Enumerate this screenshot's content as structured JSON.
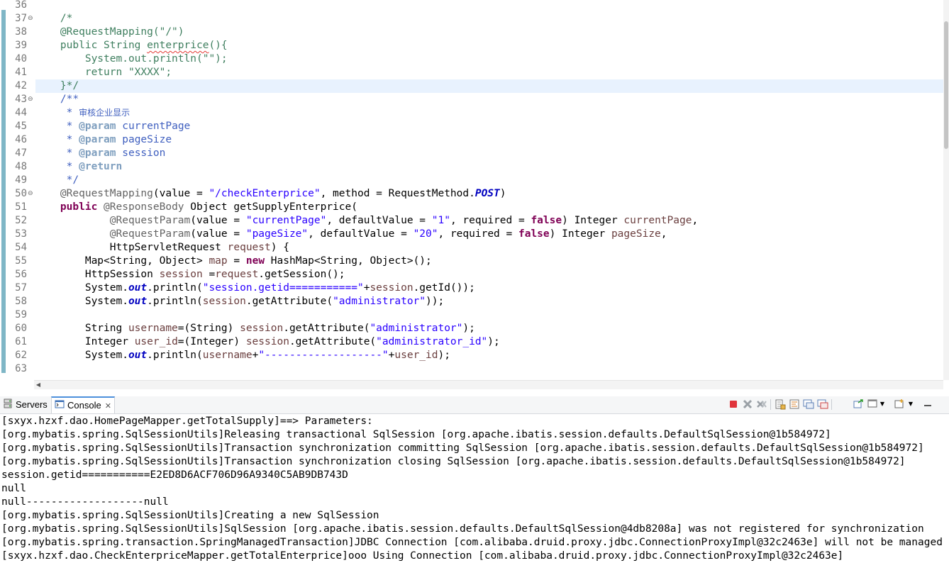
{
  "editor": {
    "line_numbers": [
      "36",
      "37",
      "38",
      "39",
      "40",
      "41",
      "42",
      "43",
      "44",
      "45",
      "46",
      "47",
      "48",
      "49",
      "50",
      "51",
      "52",
      "53",
      "54",
      "55",
      "56",
      "57",
      "58",
      "59",
      "60",
      "61",
      "62",
      "63"
    ],
    "fold_markers": [
      "37",
      "43",
      "50"
    ],
    "current_line": "42",
    "code": {
      "l37": {
        "open": "/*"
      },
      "l38": {
        "text": "@RequestMapping(\"/\")"
      },
      "l39": {
        "a": "public String ",
        "b": "enterprice",
        "c": "(){"
      },
      "l40": {
        "text": "System.out.println(\"\");"
      },
      "l41": {
        "text": "return \"XXXX\";"
      },
      "l42": {
        "text": "}*/"
      },
      "l43": {
        "text": "/**"
      },
      "l44": {
        "star": "* ",
        "text": "审核企业显示"
      },
      "l45": {
        "star": "* ",
        "tag": "@param",
        "name": " currentPage"
      },
      "l46": {
        "star": "* ",
        "tag": "@param",
        "name": " pageSize"
      },
      "l47": {
        "star": "* ",
        "tag": "@param",
        "name": " session"
      },
      "l48": {
        "star": "* ",
        "tag": "@return"
      },
      "l49": {
        "text": "*/"
      },
      "l50": {
        "ann": "@RequestMapping",
        "a": "(value = ",
        "s1": "\"/checkEnterprice\"",
        "b": ", method = RequestMethod.",
        "c": "POST",
        "d": ")"
      },
      "l51": {
        "kw": "public",
        "ann": " @ResponseBody",
        "rest": " Object getSupplyEnterprice("
      },
      "l52": {
        "ann": "@RequestParam",
        "a": "(value = ",
        "s1": "\"currentPage\"",
        "b": ", defaultValue = ",
        "s2": "\"1\"",
        "c": ", required = ",
        "kw": "false",
        "d": ") Integer ",
        "v": "currentPage",
        "e": ","
      },
      "l53": {
        "ann": "@RequestParam",
        "a": "(value = ",
        "s1": "\"pageSize\"",
        "b": ", defaultValue = ",
        "s2": "\"20\"",
        "c": ", required = ",
        "kw": "false",
        "d": ") Integer ",
        "v": "pageSize",
        "e": ","
      },
      "l54": {
        "a": "HttpServletRequest ",
        "v": "request",
        "b": ") {"
      },
      "l55": {
        "a": "Map<String, Object> ",
        "v": "map",
        "b": " = ",
        "kw": "new",
        "c": " HashMap<String, Object>();"
      },
      "l56": {
        "a": "HttpSession ",
        "v": "session",
        "b": " =",
        "v2": "request",
        "c": ".getSession();"
      },
      "l57": {
        "a": "System.",
        "f": "out",
        "b": ".println(",
        "s": "\"session.getid===========\"",
        "c": "+",
        "v": "session",
        "d": ".getId());"
      },
      "l58": {
        "a": "System.",
        "f": "out",
        "b": ".println(",
        "v": "session",
        "c": ".getAttribute(",
        "s": "\"administrator\"",
        "d": "));"
      },
      "l60": {
        "a": "String ",
        "v": "username",
        "b": "=(String) ",
        "v2": "session",
        "c": ".getAttribute(",
        "s": "\"administrator\"",
        "d": ");"
      },
      "l61": {
        "a": "Integer ",
        "v": "user_id",
        "b": "=(Integer) ",
        "v2": "session",
        "c": ".getAttribute(",
        "s": "\"administrator_id\"",
        "d": ");"
      },
      "l62": {
        "a": "System.",
        "f": "out",
        "b": ".println(",
        "v": "username",
        "c": "+",
        "s": "\"-------------------\"",
        "d": "+",
        "v2": "user_id",
        "e": ");"
      }
    }
  },
  "console_view": {
    "tabs": [
      {
        "label": "Servers",
        "icon": "servers-icon"
      },
      {
        "label": "Console",
        "icon": "console-icon",
        "active": true
      }
    ],
    "toolbar_icons": [
      "terminate-icon",
      "remove-launch-icon",
      "remove-all-terminated-icon",
      "scroll-lock-icon",
      "word-wrap-icon",
      "show-on-stdout-icon",
      "show-on-stderr-icon",
      "pin-console-icon",
      "display-console-icon",
      "open-console-icon",
      "minimize-icon"
    ],
    "output": [
      "[sxyx.hzxf.dao.HomePageMapper.getTotalSupply]==> Parameters: ",
      "[org.mybatis.spring.SqlSessionUtils]Releasing transactional SqlSession [org.apache.ibatis.session.defaults.DefaultSqlSession@1b584972]",
      "[org.mybatis.spring.SqlSessionUtils]Transaction synchronization committing SqlSession [org.apache.ibatis.session.defaults.DefaultSqlSession@1b584972]",
      "[org.mybatis.spring.SqlSessionUtils]Transaction synchronization closing SqlSession [org.apache.ibatis.session.defaults.DefaultSqlSession@1b584972]",
      "session.getid===========E2ED8D6ACF706D96A9340C5AB9DB743D",
      "null",
      "null-------------------null",
      "[org.mybatis.spring.SqlSessionUtils]Creating a new SqlSession",
      "[org.mybatis.spring.SqlSessionUtils]SqlSession [org.apache.ibatis.session.defaults.DefaultSqlSession@4db8208a] was not registered for synchronization",
      "[org.mybatis.spring.transaction.SpringManagedTransaction]JDBC Connection [com.alibaba.druid.proxy.jdbc.ConnectionProxyImpl@32c2463e] will not be managed",
      "[sxyx.hzxf.dao.CheckEnterpriceMapper.getTotalEnterprice]ooo Using Connection [com.alibaba.druid.proxy.jdbc.ConnectionProxyImpl@32c2463e]"
    ]
  }
}
